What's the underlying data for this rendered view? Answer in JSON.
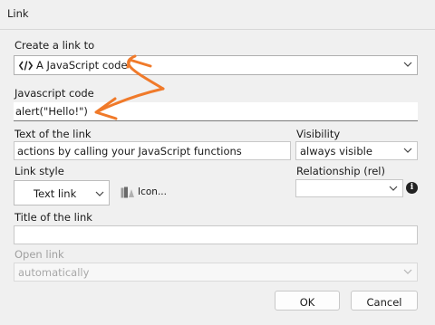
{
  "window": {
    "title": "Link"
  },
  "create_link": {
    "label": "Create a link to",
    "selected": "A JavaScript code",
    "icon": "code-icon"
  },
  "javascript_code": {
    "label": "Javascript code",
    "value": "alert(\"Hello!\")"
  },
  "link_text": {
    "label": "Text of the link",
    "value": "actions by calling your JavaScript functions"
  },
  "visibility": {
    "label": "Visibility",
    "selected": "always visible"
  },
  "link_style": {
    "label": "Link style",
    "selected": "Text link",
    "icon_button_label": "Icon..."
  },
  "relationship": {
    "label": "Relationship (rel)",
    "selected": "",
    "info_icon": "info-icon"
  },
  "title_of_link": {
    "label": "Title of the link",
    "value": ""
  },
  "open_link": {
    "label": "Open link",
    "selected": "automatically"
  },
  "buttons": {
    "ok": "OK",
    "cancel": "Cancel"
  },
  "annotation": {
    "color": "#f07a2a"
  }
}
